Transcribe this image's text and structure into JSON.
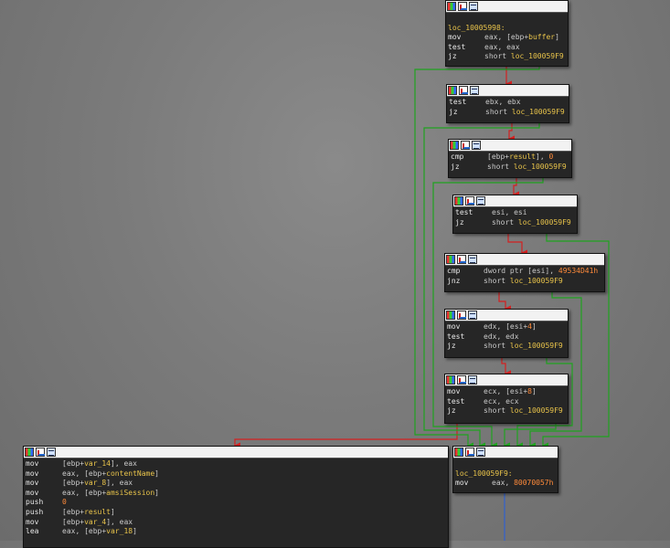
{
  "nodes": [
    {
      "id": "block-loc-10005998",
      "label": "loc_10005998:",
      "lines": [
        {
          "m": "mov",
          "parts": [
            [
              "op",
              "eax, [ebp+"
            ],
            [
              "var",
              "buffer"
            ],
            [
              "op",
              "]"
            ]
          ]
        },
        {
          "m": "test",
          "parts": [
            [
              "op",
              "eax, eax"
            ]
          ]
        },
        {
          "m": "jz",
          "parts": [
            [
              "op",
              "short "
            ],
            [
              "lbl",
              "loc_100059F9"
            ]
          ]
        }
      ]
    },
    {
      "id": "block-test-ebx",
      "lines": [
        {
          "m": "test",
          "parts": [
            [
              "op",
              "ebx, ebx"
            ]
          ]
        },
        {
          "m": "jz",
          "parts": [
            [
              "op",
              "short "
            ],
            [
              "lbl",
              "loc_100059F9"
            ]
          ]
        }
      ]
    },
    {
      "id": "block-cmp-result",
      "lines": [
        {
          "m": "cmp",
          "parts": [
            [
              "op",
              "[ebp+"
            ],
            [
              "var",
              "result"
            ],
            [
              "op",
              "], "
            ],
            [
              "num",
              "0"
            ]
          ]
        },
        {
          "m": "jz",
          "parts": [
            [
              "op",
              "short "
            ],
            [
              "lbl",
              "loc_100059F9"
            ]
          ]
        }
      ]
    },
    {
      "id": "block-test-esi",
      "lines": [
        {
          "m": "test",
          "parts": [
            [
              "op",
              "esi, esi"
            ]
          ]
        },
        {
          "m": "jz",
          "parts": [
            [
              "op",
              "short "
            ],
            [
              "lbl",
              "loc_100059F9"
            ]
          ]
        }
      ]
    },
    {
      "id": "block-cmp-dword",
      "lines": [
        {
          "m": "cmp",
          "parts": [
            [
              "op",
              "dword ptr [esi], "
            ],
            [
              "num",
              "49534D41h"
            ]
          ]
        },
        {
          "m": "jnz",
          "parts": [
            [
              "op",
              "short "
            ],
            [
              "lbl",
              "loc_100059F9"
            ]
          ]
        }
      ]
    },
    {
      "id": "block-mov-edx",
      "lines": [
        {
          "m": "mov",
          "parts": [
            [
              "op",
              "edx, [esi+"
            ],
            [
              "num",
              "4"
            ],
            [
              "op",
              "]"
            ]
          ]
        },
        {
          "m": "test",
          "parts": [
            [
              "op",
              "edx, edx"
            ]
          ]
        },
        {
          "m": "jz",
          "parts": [
            [
              "op",
              "short "
            ],
            [
              "lbl",
              "loc_100059F9"
            ]
          ]
        }
      ]
    },
    {
      "id": "block-mov-ecx",
      "lines": [
        {
          "m": "mov",
          "parts": [
            [
              "op",
              "ecx, [esi+"
            ],
            [
              "num",
              "8"
            ],
            [
              "op",
              "]"
            ]
          ]
        },
        {
          "m": "test",
          "parts": [
            [
              "op",
              "ecx, ecx"
            ]
          ]
        },
        {
          "m": "jz",
          "parts": [
            [
              "op",
              "short "
            ],
            [
              "lbl",
              "loc_100059F9"
            ]
          ]
        }
      ]
    },
    {
      "id": "block-amsi-call",
      "lines": [
        {
          "m": "mov",
          "parts": [
            [
              "op",
              "[ebp+"
            ],
            [
              "var",
              "var_14"
            ],
            [
              "op",
              "], eax"
            ]
          ]
        },
        {
          "m": "mov",
          "parts": [
            [
              "op",
              "eax, [ebp+"
            ],
            [
              "var",
              "contentName"
            ],
            [
              "op",
              "]"
            ]
          ]
        },
        {
          "m": "mov",
          "parts": [
            [
              "op",
              "[ebp+"
            ],
            [
              "var",
              "var_8"
            ],
            [
              "op",
              "], eax"
            ]
          ]
        },
        {
          "m": "mov",
          "parts": [
            [
              "op",
              "eax, [ebp+"
            ],
            [
              "var",
              "amsiSession"
            ],
            [
              "op",
              "]"
            ]
          ]
        },
        {
          "m": "push",
          "parts": [
            [
              "num",
              "0"
            ]
          ]
        },
        {
          "m": "push",
          "parts": [
            [
              "op",
              "[ebp+"
            ],
            [
              "var",
              "result"
            ],
            [
              "op",
              "]"
            ]
          ]
        },
        {
          "m": "mov",
          "parts": [
            [
              "op",
              "[ebp+"
            ],
            [
              "var",
              "var_4"
            ],
            [
              "op",
              "], eax"
            ]
          ]
        },
        {
          "m": "lea",
          "parts": [
            [
              "op",
              "eax, [ebp+"
            ],
            [
              "var",
              "var_18"
            ],
            [
              "op",
              "]"
            ]
          ]
        }
      ]
    },
    {
      "id": "block-loc-100059F9",
      "label": "loc_100059F9:",
      "lines": [
        {
          "m": "mov",
          "parts": [
            [
              "op",
              "eax, "
            ],
            [
              "num",
              "80070057h"
            ]
          ]
        }
      ]
    }
  ],
  "colors": {
    "true_edge": "#1fa31f",
    "false_edge": "#d42020",
    "flow_edge": "#3060d0",
    "background": "#7b7b7b"
  }
}
